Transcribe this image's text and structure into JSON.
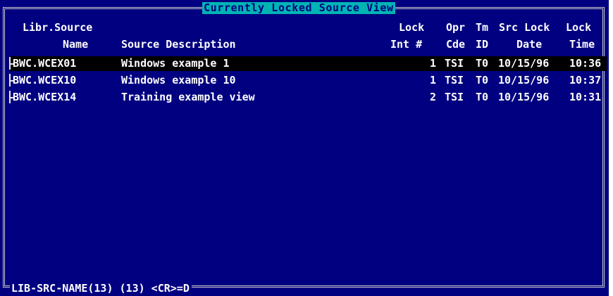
{
  "window": {
    "title": "Currently Locked Source View"
  },
  "columns": {
    "libr_source": [
      "Libr.Source",
      "Name"
    ],
    "description": [
      "",
      "Source Description"
    ],
    "lock_int": [
      "Lock",
      "Int #"
    ],
    "opr_cde": [
      "Opr",
      "Cde"
    ],
    "tm_id": [
      "Tm",
      "ID"
    ],
    "src_lock_date": [
      "Src Lock",
      "Date"
    ],
    "lock_time": [
      "Lock",
      "Time"
    ]
  },
  "rows": [
    {
      "name": "BWC.WCEX01",
      "description": "Windows example 1",
      "lock_int": "1",
      "opr_cde": "TSI",
      "tm_id": "T0",
      "date": "10/15/96",
      "time": "10:36",
      "selected": true
    },
    {
      "name": "BWC.WCEX10",
      "description": "Windows example 10",
      "lock_int": "1",
      "opr_cde": "TSI",
      "tm_id": "T0",
      "date": "10/15/96",
      "time": "10:37",
      "selected": false
    },
    {
      "name": "BWC.WCEX14",
      "description": "Training example view",
      "lock_int": "2",
      "opr_cde": "TSI",
      "tm_id": "T0",
      "date": "10/15/96",
      "time": "10:31",
      "selected": false
    }
  ],
  "status_bar": {
    "text": "LIB-SRC-NAME(13) (13) <CR>=D"
  },
  "colors": {
    "background": "#000080",
    "title_bg": "#00b4b4",
    "text": "#ffffff",
    "selection_bg": "#000000",
    "frame": "#c8c8c8"
  }
}
